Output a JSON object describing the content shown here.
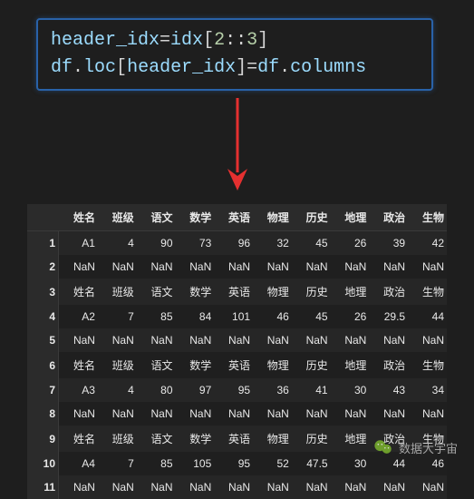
{
  "code": {
    "line1": {
      "t1": "header_idx",
      "t2": "=",
      "t3": "idx",
      "t4": "[",
      "t5": "2",
      "t6": "::",
      "t7": "3",
      "t8": "]"
    },
    "line2": {
      "t1": "df",
      "t2": ".",
      "t3": "loc",
      "t4": "[",
      "t5": "header_idx",
      "t6": "]",
      "t7": "=",
      "t8": "df",
      "t9": ".",
      "t10": "columns"
    }
  },
  "table": {
    "columns": [
      "姓名",
      "班级",
      "语文",
      "数学",
      "英语",
      "物理",
      "历史",
      "地理",
      "政治",
      "生物"
    ],
    "index": [
      "1",
      "2",
      "3",
      "4",
      "5",
      "6",
      "7",
      "8",
      "9",
      "10",
      "11"
    ],
    "rows": [
      [
        "A1",
        "4",
        "90",
        "73",
        "96",
        "32",
        "45",
        "26",
        "39",
        "42"
      ],
      [
        "NaN",
        "NaN",
        "NaN",
        "NaN",
        "NaN",
        "NaN",
        "NaN",
        "NaN",
        "NaN",
        "NaN"
      ],
      [
        "姓名",
        "班级",
        "语文",
        "数学",
        "英语",
        "物理",
        "历史",
        "地理",
        "政治",
        "生物"
      ],
      [
        "A2",
        "7",
        "85",
        "84",
        "101",
        "46",
        "45",
        "26",
        "29.5",
        "44"
      ],
      [
        "NaN",
        "NaN",
        "NaN",
        "NaN",
        "NaN",
        "NaN",
        "NaN",
        "NaN",
        "NaN",
        "NaN"
      ],
      [
        "姓名",
        "班级",
        "语文",
        "数学",
        "英语",
        "物理",
        "历史",
        "地理",
        "政治",
        "生物"
      ],
      [
        "A3",
        "4",
        "80",
        "97",
        "95",
        "36",
        "41",
        "30",
        "43",
        "34"
      ],
      [
        "NaN",
        "NaN",
        "NaN",
        "NaN",
        "NaN",
        "NaN",
        "NaN",
        "NaN",
        "NaN",
        "NaN"
      ],
      [
        "姓名",
        "班级",
        "语文",
        "数学",
        "英语",
        "物理",
        "历史",
        "地理",
        "政治",
        "生物"
      ],
      [
        "A4",
        "7",
        "85",
        "105",
        "95",
        "52",
        "47.5",
        "30",
        "44",
        "46"
      ],
      [
        "NaN",
        "NaN",
        "NaN",
        "NaN",
        "NaN",
        "NaN",
        "NaN",
        "NaN",
        "NaN",
        "NaN"
      ]
    ]
  },
  "watermark": {
    "text": "数据大宇宙"
  }
}
